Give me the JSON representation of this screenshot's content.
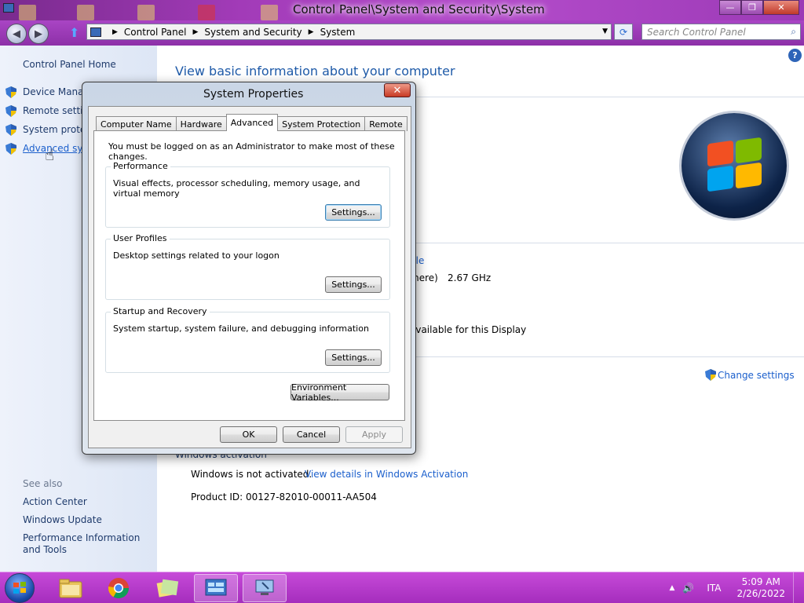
{
  "window": {
    "title": "Control Panel\\System and Security\\System",
    "minimize": "—",
    "maximize": "❐",
    "close": "✕"
  },
  "address": {
    "breadcrumb": [
      "Control Panel",
      "System and Security",
      "System"
    ],
    "search_placeholder": "Search Control Panel"
  },
  "left_pane": {
    "home": "Control Panel Home",
    "tasks": [
      "Device Manag",
      "Remote settin",
      "System protec",
      "Advanced syst"
    ],
    "see_also_label": "See also",
    "see_also": [
      "Action Center",
      "Windows Update",
      "Performance Information and Tools"
    ]
  },
  "main": {
    "heading": "View basic information about your computer",
    "partial_link": "ble",
    "processor_suffix": "mere)",
    "processor_speed": "2.67 GHz",
    "pen_touch": "available for this Display",
    "change_settings": "Change settings",
    "activation_header": "Windows activation",
    "activation_status": "Windows is not activated.",
    "activation_link": "View details in Windows Activation",
    "product_id": "Product ID: 00127-82010-00011-AA504"
  },
  "dialog": {
    "title": "System Properties",
    "tabs": [
      "Computer Name",
      "Hardware",
      "Advanced",
      "System Protection",
      "Remote"
    ],
    "active_tab": "Advanced",
    "note": "You must be logged on as an Administrator to make most of these changes.",
    "groups": [
      {
        "title": "Performance",
        "desc": "Visual effects, processor scheduling, memory usage, and virtual memory",
        "button": "Settings..."
      },
      {
        "title": "User Profiles",
        "desc": "Desktop settings related to your logon",
        "button": "Settings..."
      },
      {
        "title": "Startup and Recovery",
        "desc": "System startup, system failure, and debugging information",
        "button": "Settings..."
      }
    ],
    "env_button": "Environment Variables...",
    "ok": "OK",
    "cancel": "Cancel",
    "apply": "Apply"
  },
  "taskbar": {
    "language": "ITA",
    "time": "5:09 AM",
    "date": "2/26/2022"
  }
}
